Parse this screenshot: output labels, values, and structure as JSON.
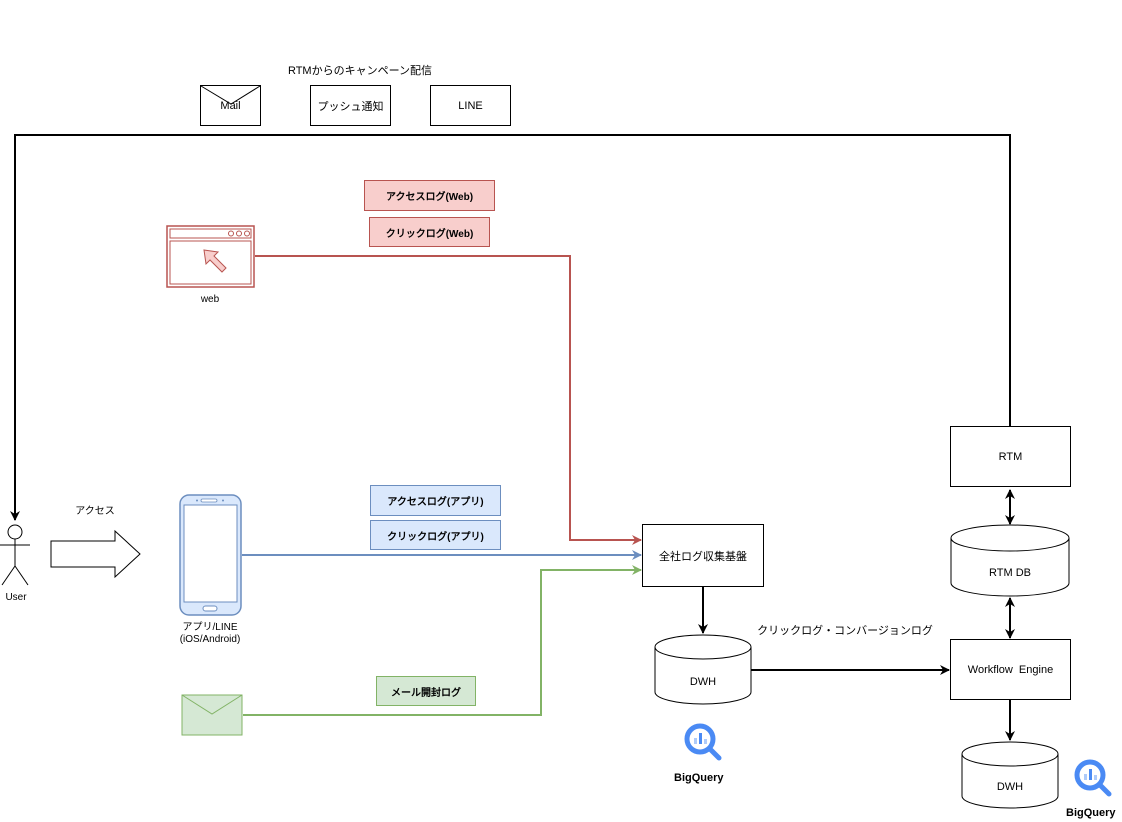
{
  "campaign": {
    "title": "RTMからのキャンペーン配信",
    "channels": [
      {
        "label": "Mail"
      },
      {
        "label": "プッシュ通知"
      },
      {
        "label": "LINE"
      }
    ]
  },
  "web": {
    "label": "web",
    "logs": [
      "アクセスログ(Web)",
      "クリックログ(Web)"
    ]
  },
  "app": {
    "label_line1": "アプリ/LINE",
    "label_line2": "(iOS/Android)",
    "logs": [
      "アクセスログ(アプリ)",
      "クリックログ(アプリ)"
    ]
  },
  "mail": {
    "log": "メール開封ログ"
  },
  "user": {
    "label": "User",
    "access_label": "アクセス"
  },
  "collector": {
    "label": "全社ログ収集基盤"
  },
  "dwh_left": {
    "label": "DWH",
    "service": "BigQuery"
  },
  "edge_label": "クリックログ・コンバージョンログ",
  "rtm": {
    "label": "RTM"
  },
  "rtm_db": {
    "label": "RTM DB"
  },
  "workflow": {
    "label": "Workflow  Engine"
  },
  "dwh_right": {
    "label": "DWH",
    "service": "BigQuery"
  },
  "colors": {
    "web_line": "#b85450",
    "app_line": "#6c8ebf",
    "mail_line": "#82b366",
    "bigquery_blue": "#4a8af4"
  }
}
